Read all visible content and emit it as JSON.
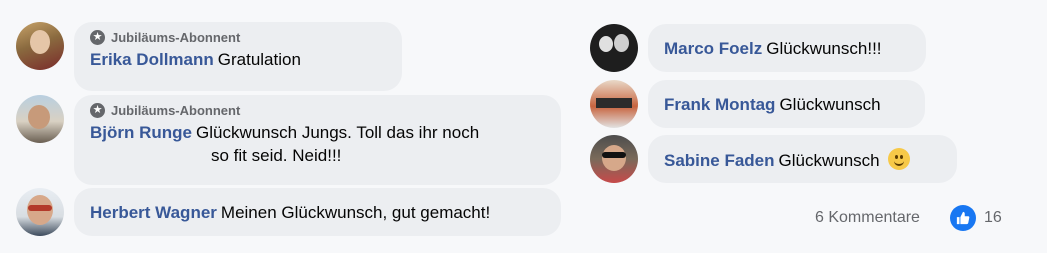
{
  "comments": [
    {
      "badge": "Jubiläums-Abonnent",
      "author": "Erika Dollmann",
      "text": "Gratulation"
    },
    {
      "badge": "Jubiläums-Abonnent",
      "author": "Björn Runge",
      "text_line1": "Glückwunsch Jungs. Toll das ihr noch",
      "text_line2": "so fit seid.  Neid!!!"
    },
    {
      "author": "Herbert Wagner",
      "text": "Meinen Glückwunsch, gut gemacht!"
    },
    {
      "author": "Marco Foelz",
      "text": "Glückwunsch!!!"
    },
    {
      "author": "Frank Montag",
      "text": "Glückwunsch"
    },
    {
      "author": "Sabine Faden",
      "text": "Glückwunsch"
    }
  ],
  "footer": {
    "comments_count": "6 Kommentare",
    "likes_count": "16"
  },
  "icons": {
    "badge": "jubilee-badge-icon",
    "like": "thumbs-up-icon",
    "emoji": "smiling-face-emoji"
  }
}
